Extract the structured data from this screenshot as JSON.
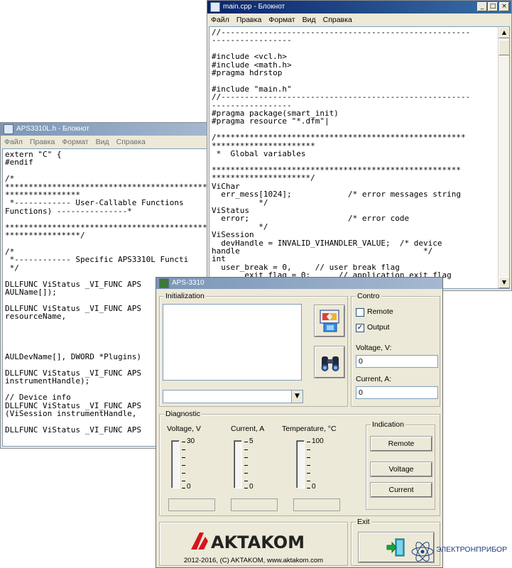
{
  "header_window": {
    "title": "APS3310L.h - Блокнот",
    "menu": [
      "Файл",
      "Правка",
      "Формат",
      "Вид",
      "Справка"
    ],
    "code_lines": [
      "extern \"C\" {",
      "#endif",
      "",
      "/*",
      "*************************************************",
      "****************",
      " *------------ User-Callable Functions",
      "Functions) ---------------*",
      "",
      "*************************************************",
      "****************/",
      "",
      "/*",
      " *------------ Specific APS3310L Functi",
      " */",
      "",
      "DLLFUNC ViStatus _VI_FUNC APS",
      "AULName[]);",
      "",
      "DLLFUNC ViStatus _VI_FUNC APS",
      "resourceName,",
      "",
      "",
      "",
      "",
      "AULDevName[], DWORD *Plugins)",
      "",
      "DLLFUNC ViStatus _VI_FUNC APS",
      "instrumentHandle);",
      "",
      "// Device info",
      "DLLFUNC ViStatus _VI_FUNC APS",
      "(ViSession instrumentHandle,",
      "",
      "DLLFUNC ViStatus _VI_FUNC APS"
    ]
  },
  "main_window": {
    "title": "main.cpp - Блокнот",
    "menu": [
      "Файл",
      "Правка",
      "Формат",
      "Вид",
      "Справка"
    ],
    "code_lines": [
      "//-----------------------------------------------------",
      "-----------------",
      "",
      "#include <vcl.h>",
      "#include <math.h>",
      "#pragma hdrstop",
      "",
      "#include \"main.h\"",
      "//-----------------------------------------------------",
      "-----------------",
      "#pragma package(smart_init)",
      "#pragma resource \"*.dfm\"|",
      "",
      "/*****************************************************",
      "**********************",
      " *  Global variables",
      "",
      "*****************************************************",
      "*********************/",
      "ViChar",
      "  err_mess[1024];            /* error messages string",
      "          */",
      "ViStatus",
      "  error;                     /* error code",
      "          */",
      "ViSession",
      "  devHandle = INVALID_VIHANDLER_VALUE;  /* device",
      "handle                                       */",
      "int",
      "  user_break = 0,     // user break flag",
      "       exit_flag = 0;      // application exit flag"
    ]
  },
  "app": {
    "title": "APS-3310",
    "initialization": {
      "label": "Initialization",
      "dropdown_value": ""
    },
    "control": {
      "label": "Contro",
      "remote_label": "Remote",
      "remote_checked": false,
      "output_label": "Output",
      "output_checked": true,
      "voltage_label": "Voltage, V:",
      "voltage_value": "0",
      "current_label": "Current, A:",
      "current_value": "0"
    },
    "diagnostic": {
      "label": "Diagnostic",
      "voltage": {
        "label": "Voltage, V",
        "max": "30",
        "min": "0",
        "value": ""
      },
      "current": {
        "label": "Current, A",
        "max": "5",
        "min": "0",
        "value": ""
      },
      "temperature": {
        "label": "Temperature, °C",
        "max": "100",
        "min": "0",
        "value": ""
      }
    },
    "indication": {
      "label": "Indication",
      "remote": "Remote",
      "voltage": "Voltage",
      "current": "Current"
    },
    "exit": {
      "label": "Exit"
    },
    "footer": {
      "logo": "AKTAKOM",
      "copyright": "2012-2016, (C) AKTAKOM, www.aktakom.com"
    }
  },
  "watermark": {
    "text": "ЭЛЕКТРОНПРИБОР"
  },
  "colors": {
    "logo_red": "#d8141b",
    "logo_text": "#222222",
    "watermark_blue": "#1d3d7a"
  }
}
